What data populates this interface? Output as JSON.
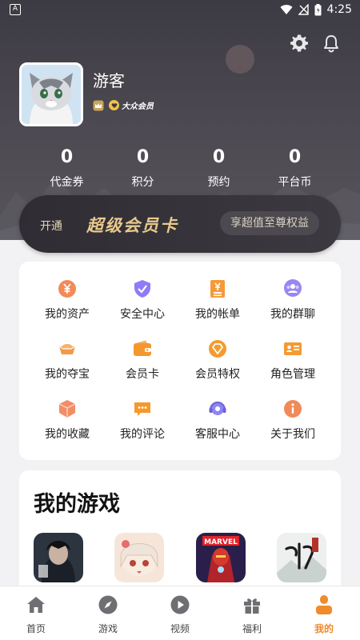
{
  "status_bar": {
    "time": "4:25",
    "left_glyph": "A"
  },
  "profile": {
    "username": "游客",
    "member_badge": "大众会员"
  },
  "stats": [
    {
      "value": "0",
      "label": "代金券"
    },
    {
      "value": "0",
      "label": "积分"
    },
    {
      "value": "0",
      "label": "预约"
    },
    {
      "value": "0",
      "label": "平台币"
    }
  ],
  "vip": {
    "prefix": "开通",
    "title": "超级会员卡",
    "button": "享超值至尊权益"
  },
  "menu": {
    "items": [
      {
        "label": "我的资产",
        "icon": "yen-coin-icon"
      },
      {
        "label": "安全中心",
        "icon": "shield-check-icon"
      },
      {
        "label": "我的帐单",
        "icon": "bill-icon"
      },
      {
        "label": "我的群聊",
        "icon": "group-chat-icon"
      },
      {
        "label": "我的夺宝",
        "icon": "treasure-ingot-icon"
      },
      {
        "label": "会员卡",
        "icon": "wallet-card-icon"
      },
      {
        "label": "会员特权",
        "icon": "diamond-icon"
      },
      {
        "label": "角色管理",
        "icon": "id-card-icon"
      },
      {
        "label": "我的收藏",
        "icon": "favorite-box-icon"
      },
      {
        "label": "我的评论",
        "icon": "comment-icon"
      },
      {
        "label": "客服中心",
        "icon": "headset-icon"
      },
      {
        "label": "关于我们",
        "icon": "info-icon"
      }
    ]
  },
  "games": {
    "title": "我的游戏",
    "icons": [
      {
        "icon": "game-icon-warrior"
      },
      {
        "icon": "game-icon-anime-girl"
      },
      {
        "icon": "game-icon-marvel"
      },
      {
        "icon": "game-icon-zhuxian"
      }
    ]
  },
  "tabbar": {
    "tabs": [
      {
        "label": "首页",
        "icon": "home-icon"
      },
      {
        "label": "游戏",
        "icon": "compass-icon"
      },
      {
        "label": "视频",
        "icon": "play-icon"
      },
      {
        "label": "福利",
        "icon": "gift-icon"
      },
      {
        "label": "我的",
        "icon": "user-icon"
      }
    ],
    "active": "我的"
  },
  "colors": {
    "accent": "#f08a2c",
    "header_bg": "#46434b",
    "vip_gold": "#e9c98d"
  }
}
